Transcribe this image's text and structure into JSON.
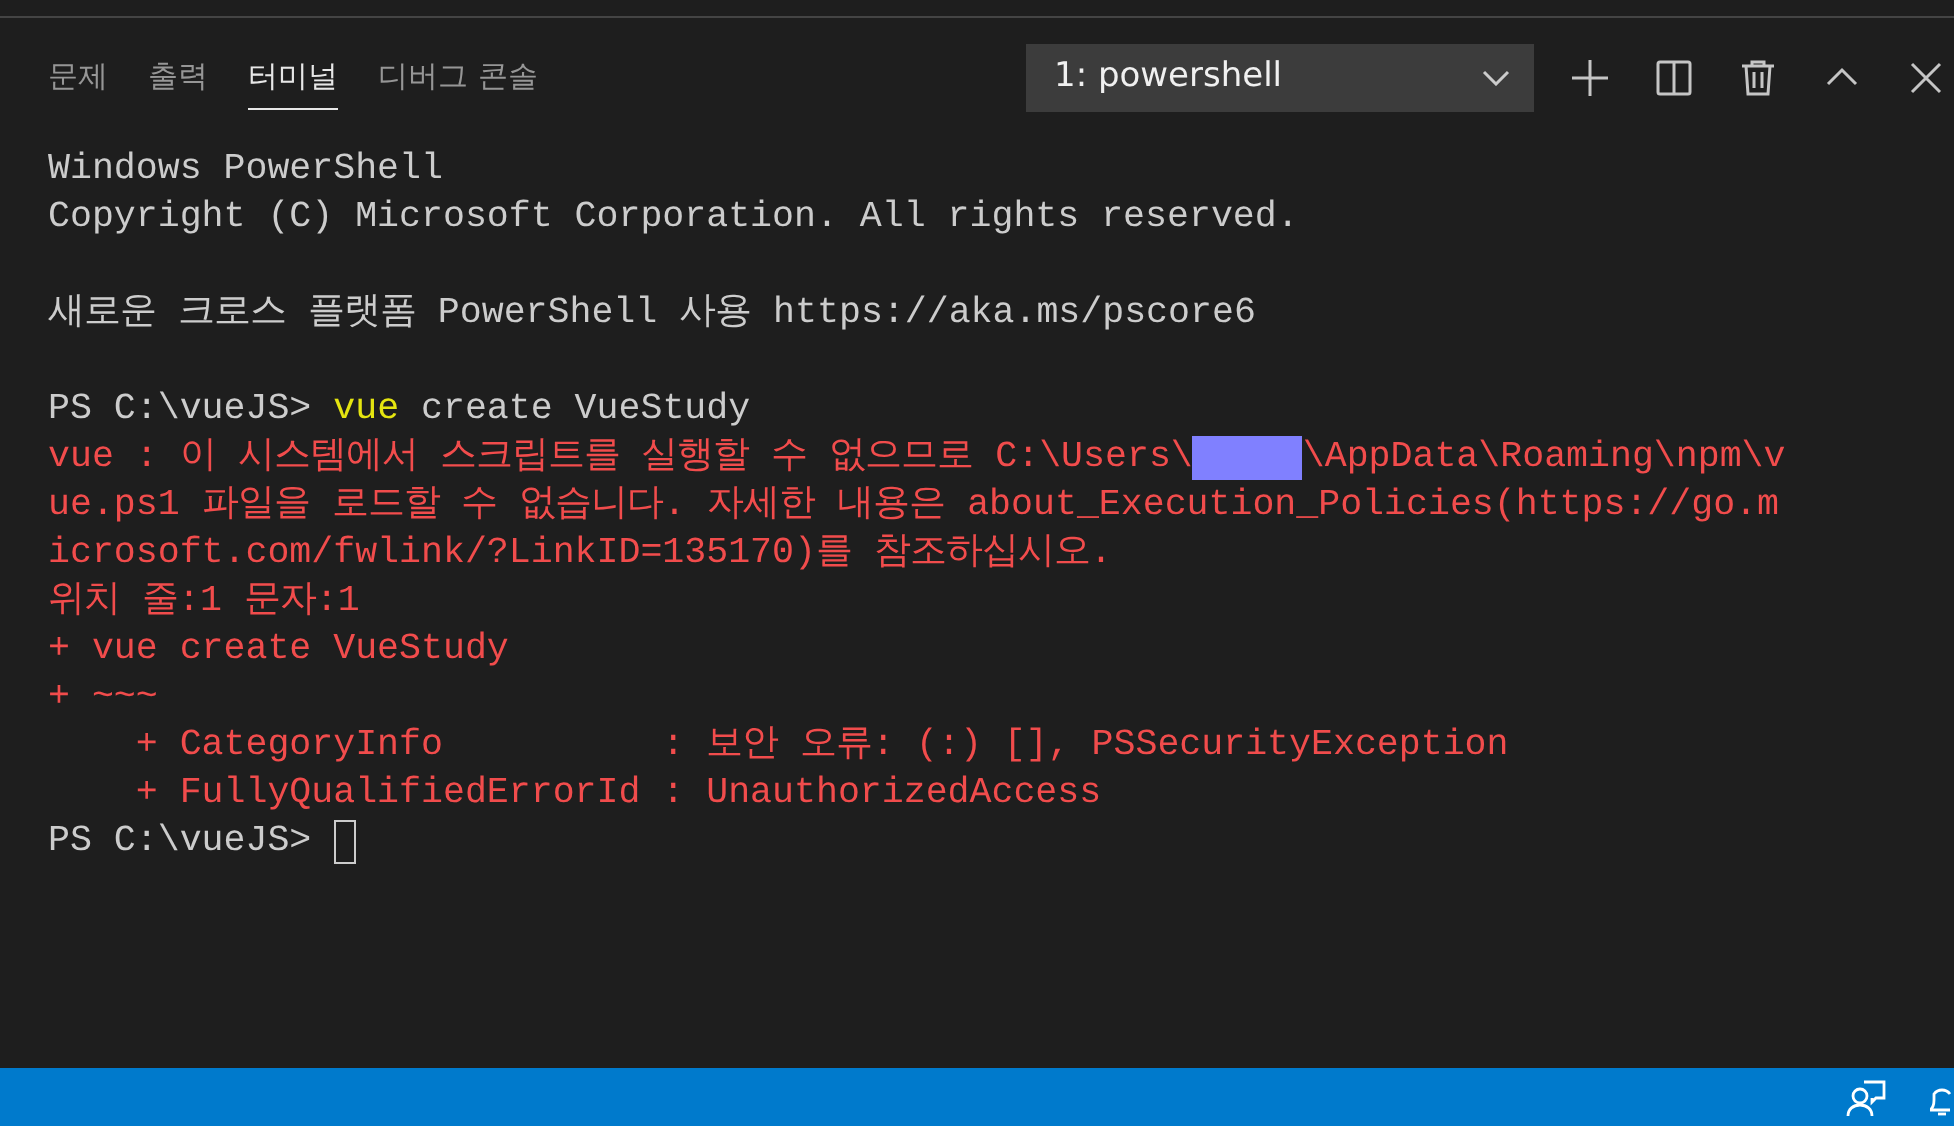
{
  "panel_tabs": [
    {
      "label": "문제",
      "selected": false
    },
    {
      "label": "출력",
      "selected": false
    },
    {
      "label": "터미널",
      "selected": true
    },
    {
      "label": "디버그 콘솔",
      "selected": false
    }
  ],
  "terminal_select": {
    "value": "1: powershell"
  },
  "terminal": {
    "lines": [
      {
        "kind": "text",
        "cursor": false,
        "segments": [
          {
            "kind": "normal",
            "text": "Windows PowerShell"
          }
        ]
      },
      {
        "kind": "text",
        "cursor": false,
        "segments": [
          {
            "kind": "normal",
            "text": "Copyright (C) Microsoft Corporation. All rights reserved."
          }
        ]
      },
      {
        "kind": "blank",
        "cursor": false
      },
      {
        "kind": "text",
        "cursor": false,
        "segments": [
          {
            "kind": "normal",
            "text": "새로운 크로스 플랫폼 PowerShell 사용 https://aka.ms/pscore6"
          }
        ]
      },
      {
        "kind": "blank",
        "cursor": false
      },
      {
        "kind": "text",
        "cursor": false,
        "segments": [
          {
            "kind": "normal",
            "text": "PS C:\\vueJS> "
          },
          {
            "kind": "command",
            "text": "vue"
          },
          {
            "kind": "normal",
            "text": " create VueStudy"
          }
        ]
      },
      {
        "kind": "text",
        "cursor": false,
        "segments": [
          {
            "kind": "error",
            "text": "vue : 이 시스템에서 스크립트를 실행할 수 없으므로 C:\\Users\\"
          },
          {
            "kind": "redacted"
          },
          {
            "kind": "error",
            "text": "\\AppData\\Roaming\\npm\\v"
          }
        ]
      },
      {
        "kind": "text",
        "cursor": false,
        "segments": [
          {
            "kind": "error",
            "text": "ue.ps1 파일을 로드할 수 없습니다. 자세한 내용은 about_Execution_Policies(https://go.m"
          }
        ]
      },
      {
        "kind": "text",
        "cursor": false,
        "segments": [
          {
            "kind": "error",
            "text": "icrosoft.com/fwlink/?LinkID=135170)를 참조하십시오."
          }
        ]
      },
      {
        "kind": "text",
        "cursor": false,
        "segments": [
          {
            "kind": "error",
            "text": "위치 줄:1 문자:1"
          }
        ]
      },
      {
        "kind": "text",
        "cursor": false,
        "segments": [
          {
            "kind": "error",
            "text": "+ vue create VueStudy"
          }
        ]
      },
      {
        "kind": "text",
        "cursor": false,
        "segments": [
          {
            "kind": "error",
            "text": "+ ~~~"
          }
        ]
      },
      {
        "kind": "text",
        "cursor": false,
        "segments": [
          {
            "kind": "error",
            "text": "    + CategoryInfo          : 보안 오류: (:) [], PSSecurityException"
          }
        ]
      },
      {
        "kind": "text",
        "cursor": false,
        "segments": [
          {
            "kind": "error",
            "text": "    + FullyQualifiedErrorId : UnauthorizedAccess"
          }
        ]
      },
      {
        "kind": "text",
        "cursor": true,
        "segments": [
          {
            "kind": "normal",
            "text": "PS C:\\vueJS> "
          }
        ]
      }
    ]
  }
}
